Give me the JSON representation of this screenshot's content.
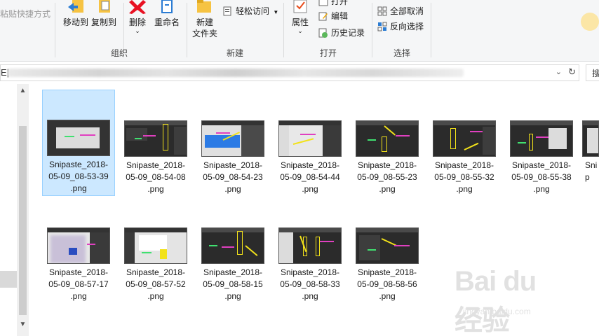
{
  "ribbon": {
    "clipboard_partial": "粘贴快捷方式",
    "organize": {
      "label": "组织",
      "move_to": "移动到",
      "copy_to": "复制到",
      "delete": "删除",
      "rename": "重命名"
    },
    "new": {
      "label": "新建",
      "new_folder_line1": "新建",
      "new_folder_line2": "文件夹",
      "easy_access": "轻松访问"
    },
    "open": {
      "label": "打开",
      "properties": "属性",
      "open_partial": "打开",
      "edit": "编辑",
      "history": "历史记录"
    },
    "select": {
      "label": "选择",
      "select_none": "全部取消",
      "invert": "反向选择"
    }
  },
  "address": {
    "prefix": "E|",
    "search_partial": "搜"
  },
  "files": [
    {
      "name": "Snipaste_2018-05-09_08-53-39.png",
      "l1": "Snipaste_2018-",
      "l2": "05-09_08-53-39",
      "l3": ".png"
    },
    {
      "name": "Snipaste_2018-05-09_08-54-08.png",
      "l1": "Snipaste_2018-",
      "l2": "05-09_08-54-08",
      "l3": ".png"
    },
    {
      "name": "Snipaste_2018-05-09_08-54-23.png",
      "l1": "Snipaste_2018-",
      "l2": "05-09_08-54-23",
      "l3": ".png"
    },
    {
      "name": "Snipaste_2018-05-09_08-54-44.png",
      "l1": "Snipaste_2018-",
      "l2": "05-09_08-54-44",
      "l3": ".png"
    },
    {
      "name": "Snipaste_2018-05-09_08-55-23.png",
      "l1": "Snipaste_2018-",
      "l2": "05-09_08-55-23",
      "l3": ".png"
    },
    {
      "name": "Snipaste_2018-05-09_08-55-32.png",
      "l1": "Snipaste_2018-",
      "l2": "05-09_08-55-32",
      "l3": ".png"
    },
    {
      "name": "Snipaste_2018-05-09_08-55-38.png",
      "l1": "Snipaste_2018-",
      "l2": "05-09_08-55-38",
      "l3": ".png"
    },
    {
      "name": "Snipaste_2018-05-09_08-57-17.png",
      "l1": "Snipaste_2018-",
      "l2": "05-09_08-57-17",
      "l3": ".png"
    },
    {
      "name": "Snipaste_2018-05-09_08-57-52.png",
      "l1": "Snipaste_2018-",
      "l2": "05-09_08-57-52",
      "l3": ".png"
    },
    {
      "name": "Snipaste_2018-05-09_08-58-15.png",
      "l1": "Snipaste_2018-",
      "l2": "05-09_08-58-15",
      "l3": ".png"
    },
    {
      "name": "Snipaste_2018-05-09_08-58-33.png",
      "l1": "Snipaste_2018-",
      "l2": "05-09_08-58-33",
      "l3": ".png"
    },
    {
      "name": "Snipaste_2018-05-09_08-58-56.png",
      "l1": "Snipaste_2018-",
      "l2": "05-09_08-58-56",
      "l3": ".png"
    },
    {
      "name": "Snip (partial)",
      "l1": "Snip",
      "l2": "",
      "l3": ""
    }
  ],
  "watermark": {
    "logo": "Bai du 经验",
    "sub": "jingyan.baidu.com"
  },
  "colors": {
    "selection": "#cce8ff",
    "ribbon_bg": "#f5f6f7",
    "delete_red": "#e81123",
    "folder_yellow": "#f6c343"
  }
}
